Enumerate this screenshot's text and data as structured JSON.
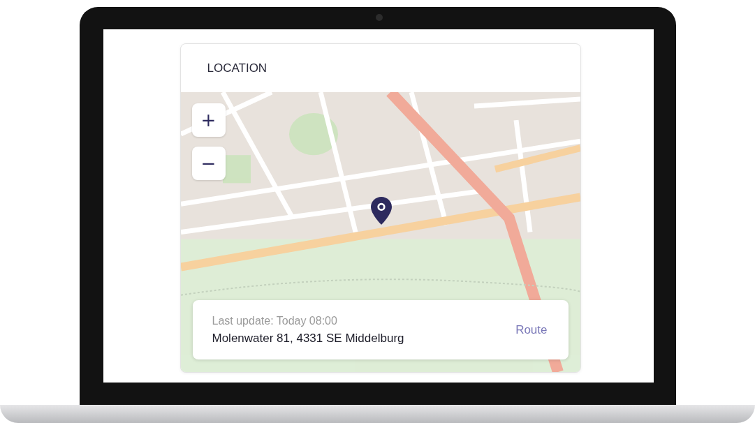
{
  "card": {
    "title": "LOCATION"
  },
  "zoom_controls": [
    {
      "label": "+"
    },
    {
      "label": "−"
    }
  ],
  "location": {
    "last_update": "Last update: Today 08:00",
    "address": "Molenwater 81, 4331 SE Middelburg",
    "action": "Route"
  }
}
